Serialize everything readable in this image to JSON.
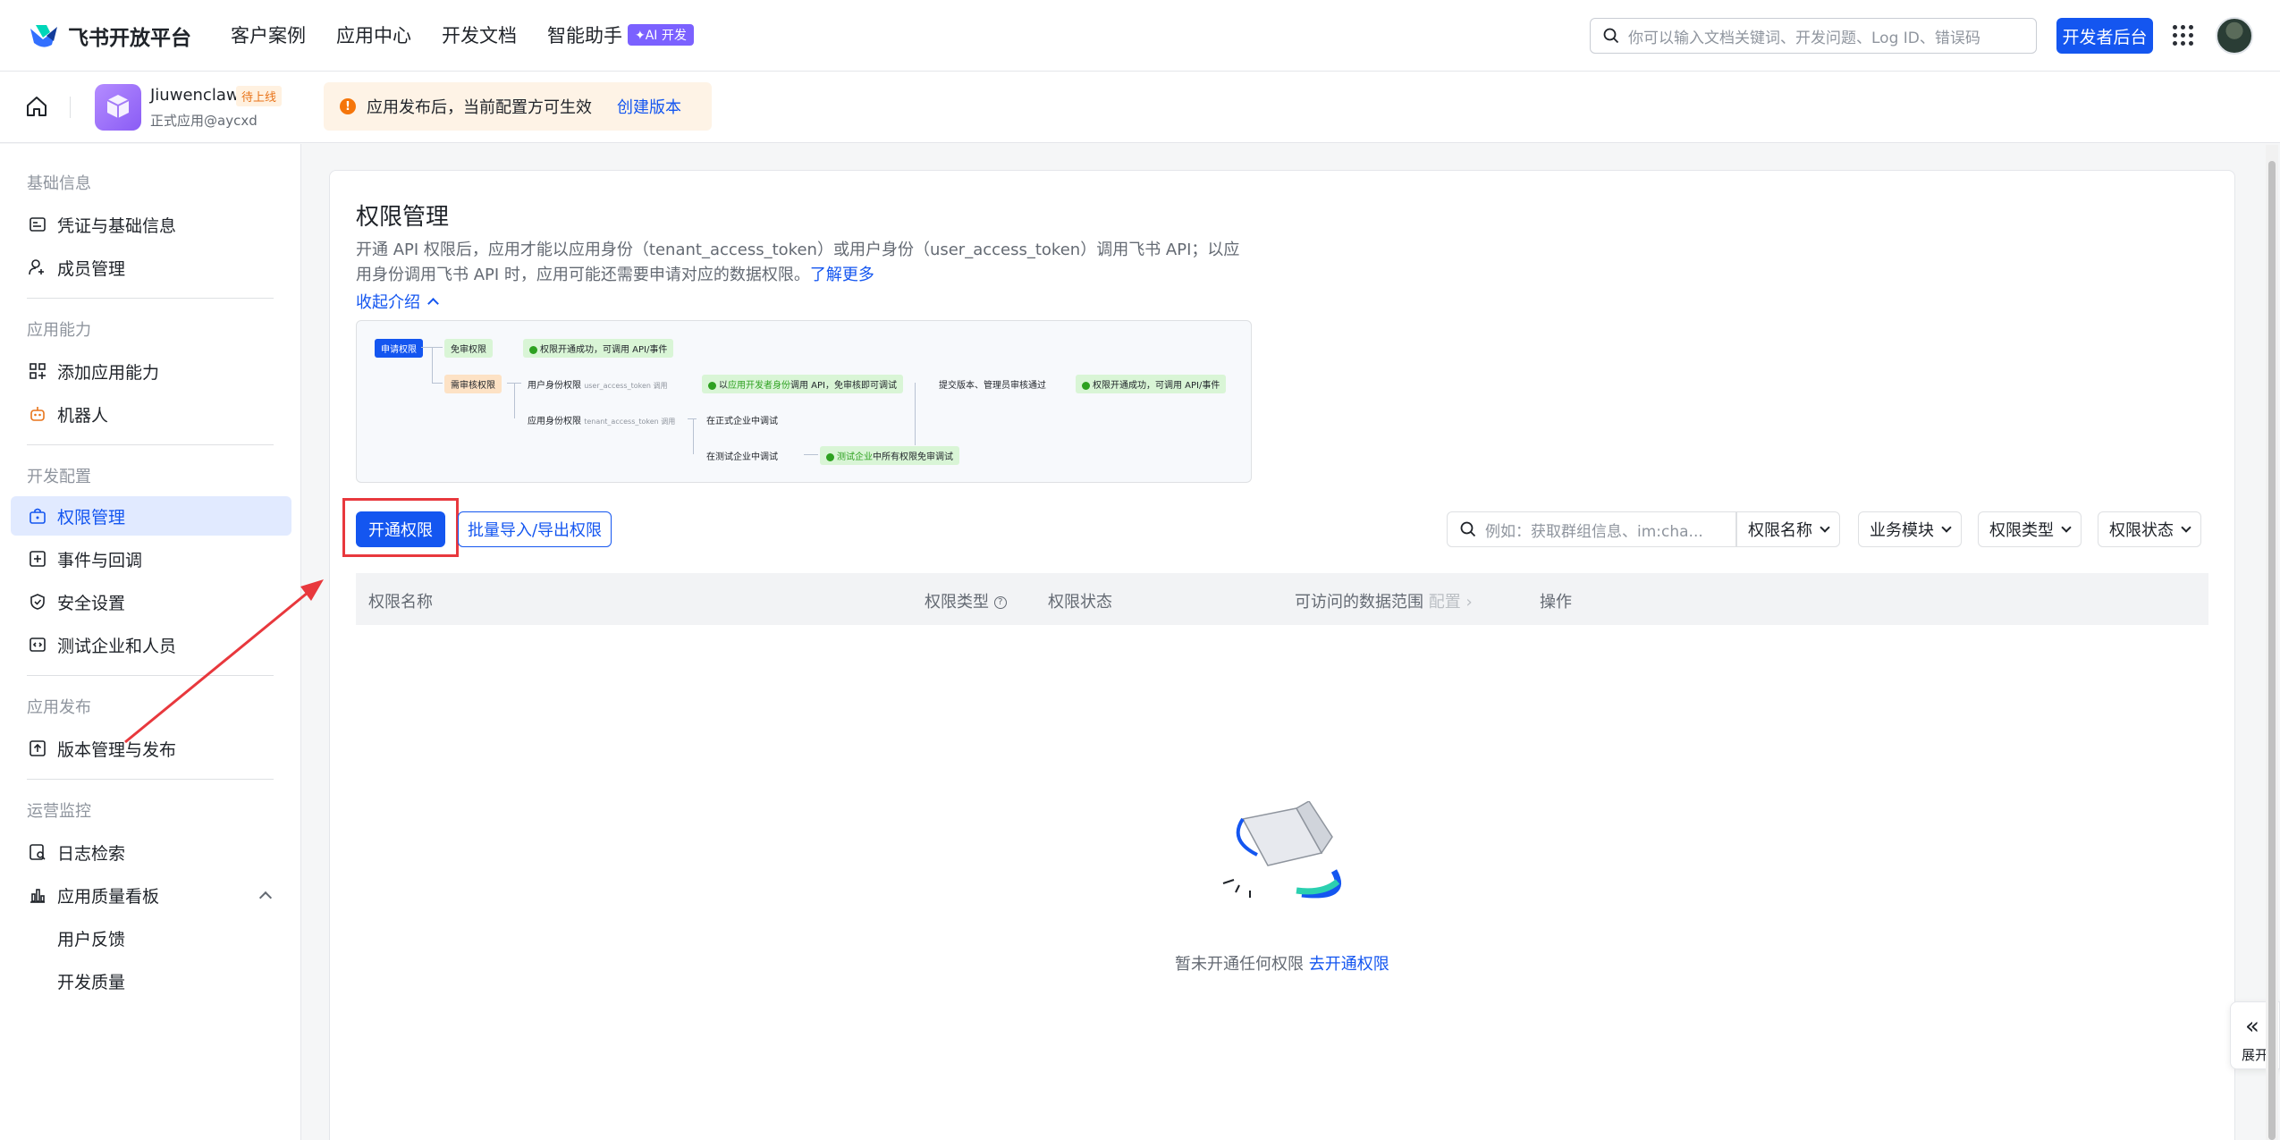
{
  "nav": {
    "logo_text": "飞书开放平台",
    "links": [
      "客户案例",
      "应用中心",
      "开发文档",
      "智能助手"
    ],
    "ai_badge": "✦AI 开发",
    "search_placeholder": "你可以输入文档关键词、开发问题、Log ID、错误码",
    "dev_console": "开发者后台"
  },
  "app": {
    "name": "Jiuwenclaw",
    "status_badge": "待上线",
    "subtitle": "正式应用@aycxd",
    "notice": "应用发布后，当前配置方可生效",
    "notice_action": "创建版本"
  },
  "sidebar": {
    "sections": [
      {
        "title": "基础信息",
        "items": [
          "凭证与基础信息",
          "成员管理"
        ]
      },
      {
        "title": "应用能力",
        "items": [
          "添加应用能力",
          "机器人"
        ]
      },
      {
        "title": "开发配置",
        "items": [
          "权限管理",
          "事件与回调",
          "安全设置",
          "测试企业和人员"
        ]
      },
      {
        "title": "应用发布",
        "items": [
          "版本管理与发布"
        ]
      },
      {
        "title": "运营监控",
        "items": [
          "日志检索",
          "应用质量看板",
          "用户反馈",
          "开发质量"
        ]
      }
    ]
  },
  "main": {
    "title": "权限管理",
    "desc": "开通 API 权限后，应用才能以应用身份（tenant_access_token）或用户身份（user_access_token）调用飞书 API；以应用身份调用飞书 API 时，应用可能还需要申请对应的数据权限。",
    "learn_more": "了解更多",
    "collapse": "收起介绍",
    "flow": {
      "apply": "申请权限",
      "no_review": "免审权限",
      "success1": "权限开通成功，可调用 API/事件",
      "need_review": "需审核权限",
      "user_perm": "用户身份权限",
      "user_token": "user_access_token 调用",
      "dev_debug_prefix": "以",
      "dev_debug_hl": "应用开发者身份",
      "dev_debug_suffix": "调用 API，免审核即可调试",
      "submit": "提交版本、管理员审核通过",
      "success2": "权限开通成功，可调用 API/事件",
      "app_perm": "应用身份权限",
      "tenant_token": "tenant_access_token 调用",
      "formal_debug": "在正式企业中调试",
      "test_debug": "在测试企业中调试",
      "test_all_hl": "测试企业",
      "test_all_suffix": "中所有权限免审调试"
    },
    "btn_open": "开通权限",
    "btn_batch": "批量导入/导出权限",
    "filter_placeholder": "例如：获取群组信息、im:cha...",
    "filters": [
      "权限名称",
      "业务模块",
      "权限类型",
      "权限状态"
    ],
    "columns": [
      "权限名称",
      "权限类型",
      "权限状态",
      "可访问的数据范围",
      "配置",
      "操作"
    ],
    "empty_text": "暂未开通任何权限",
    "empty_link": "去开通权限",
    "expand": "展开"
  }
}
